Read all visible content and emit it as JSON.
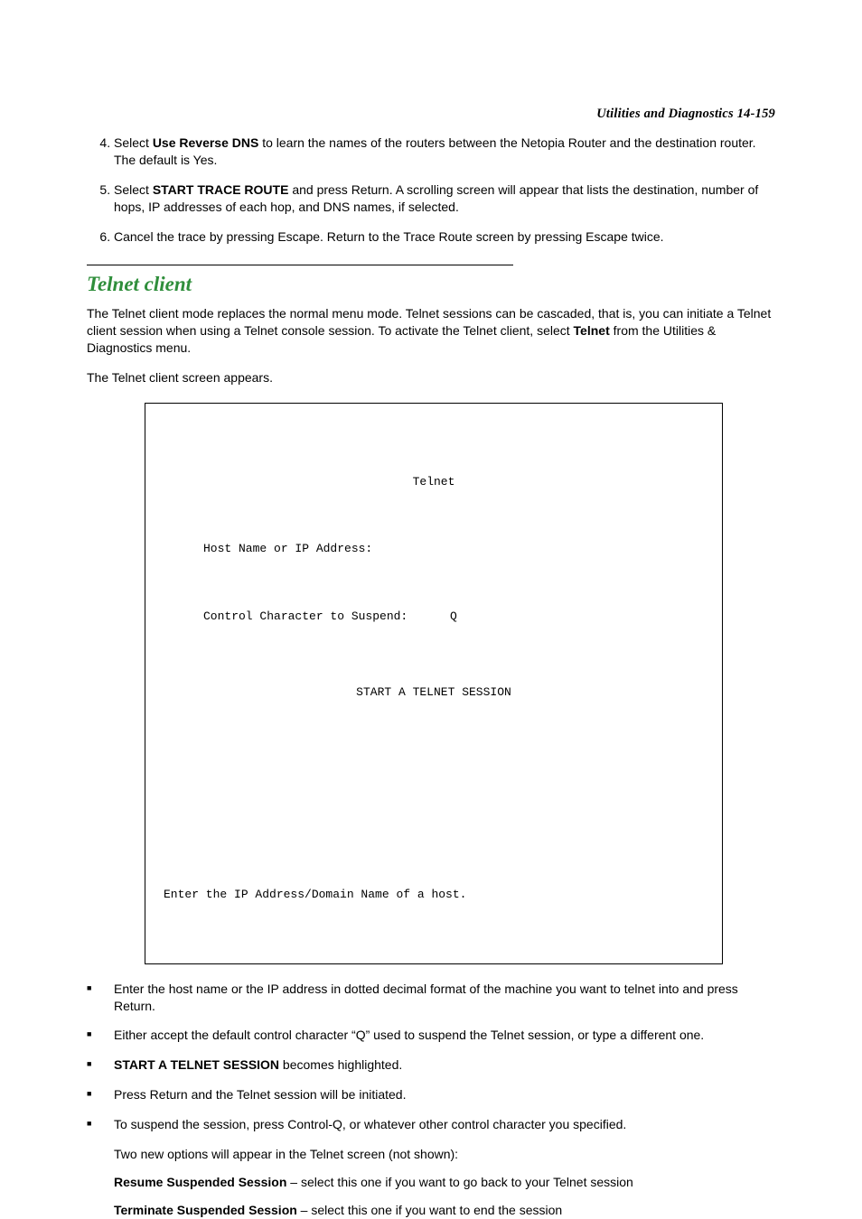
{
  "header": {
    "running": "Utilities and Diagnostics   14-159"
  },
  "steps": {
    "start": 4,
    "items": [
      {
        "pre": "Select ",
        "bold": "Use Reverse DNS",
        "post": " to learn the names of the routers between the Netopia Router and the destination router. The default is Yes."
      },
      {
        "pre": "Select ",
        "bold": "START TRACE ROUTE",
        "post": " and press Return. A scrolling screen will appear that lists the destination, number of hops, IP addresses of each hop, and DNS names, if selected."
      },
      {
        "pre": "",
        "bold": "",
        "post": "Cancel the trace by pressing Escape. Return to the Trace Route screen by pressing Escape twice."
      }
    ]
  },
  "section_title": "Telnet client",
  "para1_a": "The Telnet client mode replaces the normal menu mode. Telnet sessions can be cascaded, that is, you can initiate a Telnet client session when using a Telnet console session. To activate the Telnet client, select ",
  "para1_bold": "Telnet",
  "para1_b": " from the Utilities & Diagnostics menu.",
  "para2": "The Telnet client screen appears.",
  "terminal": {
    "title": "Telnet",
    "l1": "Host Name or IP Address:",
    "l2": "Control Character to Suspend:      Q",
    "center": "START A TELNET SESSION",
    "footer": "Enter the IP Address/Domain Name of a host."
  },
  "bullets": [
    {
      "pre": "",
      "bold": "",
      "post": "Enter the host name or the IP address in dotted decimal format of the machine you want to telnet into and press Return."
    },
    {
      "pre": "",
      "bold": "",
      "post": "Either accept the default control character “Q” used to suspend the Telnet session, or type a different one."
    },
    {
      "pre": "",
      "bold": "START A TELNET SESSION",
      "post": " becomes highlighted."
    },
    {
      "pre": "",
      "bold": "",
      "post": "Press Return and the Telnet session will be initiated."
    },
    {
      "pre": "",
      "bold": "",
      "post": "To suspend the session, press Control-Q, or whatever other control character you specified."
    }
  ],
  "sub1": "Two new options will appear in the Telnet screen (not shown):",
  "sub2_bold": "Resume Suspended Session",
  "sub2_rest": " – select this one if you want to go back to your Telnet session",
  "sub3_bold": "Terminate Suspended Session",
  "sub3_rest": " – select this one if you want to end the session"
}
